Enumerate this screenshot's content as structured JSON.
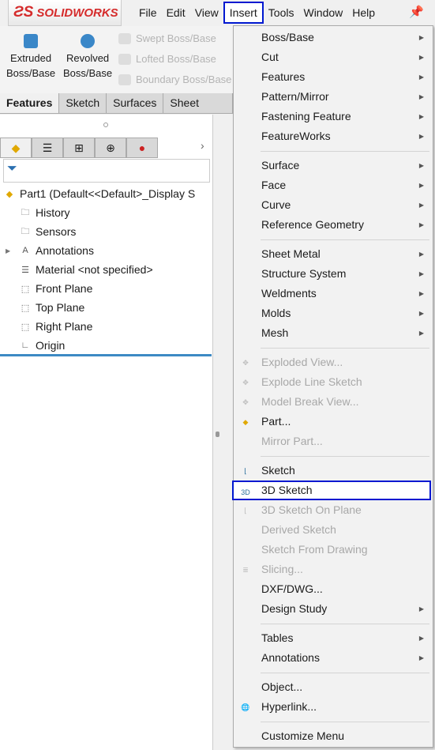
{
  "app": {
    "brand": "SOLIDWORKS"
  },
  "menubar": [
    "File",
    "Edit",
    "View",
    "Insert",
    "Tools",
    "Window",
    "Help"
  ],
  "ribbon": {
    "big": [
      {
        "label1": "Extruded",
        "label2": "Boss/Base",
        "icon": "extrude-icon"
      },
      {
        "label1": "Revolved",
        "label2": "Boss/Base",
        "icon": "revolve-icon"
      }
    ],
    "small": [
      {
        "label": "Swept Boss/Base",
        "icon": "swept-icon"
      },
      {
        "label": "Lofted Boss/Base",
        "icon": "lofted-icon"
      },
      {
        "label": "Boundary Boss/Base",
        "icon": "boundary-icon"
      }
    ]
  },
  "tabs": [
    "Features",
    "Sketch",
    "Surfaces",
    "Sheet Metal"
  ],
  "tree": {
    "root": "Part1  (Default<<Default>_Display S",
    "items": [
      {
        "label": "History",
        "icon": "history-folder-icon"
      },
      {
        "label": "Sensors",
        "icon": "sensors-folder-icon"
      },
      {
        "label": "Annotations",
        "icon": "annotations-folder-icon",
        "expandable": true
      },
      {
        "label": "Material <not specified>",
        "icon": "material-icon"
      },
      {
        "label": "Front Plane",
        "icon": "plane-icon"
      },
      {
        "label": "Top Plane",
        "icon": "plane-icon"
      },
      {
        "label": "Right Plane",
        "icon": "plane-icon"
      },
      {
        "label": "Origin",
        "icon": "origin-icon"
      }
    ]
  },
  "menu": [
    {
      "label": "Boss/Base",
      "sub": true
    },
    {
      "label": "Cut",
      "sub": true
    },
    {
      "label": "Features",
      "sub": true
    },
    {
      "label": "Pattern/Mirror",
      "sub": true
    },
    {
      "label": "Fastening Feature",
      "sub": true
    },
    {
      "label": "FeatureWorks",
      "sub": true
    },
    {
      "sep": true
    },
    {
      "label": "Surface",
      "sub": true
    },
    {
      "label": "Face",
      "sub": true
    },
    {
      "label": "Curve",
      "sub": true
    },
    {
      "label": "Reference Geometry",
      "sub": true
    },
    {
      "sep": true
    },
    {
      "label": "Sheet Metal",
      "sub": true
    },
    {
      "label": "Structure System",
      "sub": true
    },
    {
      "label": "Weldments",
      "sub": true
    },
    {
      "label": "Molds",
      "sub": true
    },
    {
      "label": "Mesh",
      "sub": true
    },
    {
      "sep": true
    },
    {
      "label": "Exploded View...",
      "disabled": true,
      "icon": "exploded-view-icon"
    },
    {
      "label": "Explode Line Sketch",
      "disabled": true,
      "icon": "explode-line-icon"
    },
    {
      "label": "Model Break View...",
      "disabled": true,
      "icon": "model-break-icon"
    },
    {
      "label": "Part...",
      "icon": "part-icon"
    },
    {
      "label": "Mirror Part...",
      "disabled": true
    },
    {
      "sep": true
    },
    {
      "label": "Sketch",
      "icon": "sketch-icon"
    },
    {
      "label": "3D Sketch",
      "icon": "3d-sketch-icon",
      "highlighted": true
    },
    {
      "label": "3D Sketch On Plane",
      "disabled": true,
      "icon": "3d-sketch-plane-icon"
    },
    {
      "label": "Derived Sketch",
      "disabled": true
    },
    {
      "label": "Sketch From Drawing",
      "disabled": true
    },
    {
      "label": "Slicing...",
      "disabled": true,
      "icon": "slicing-icon"
    },
    {
      "label": "DXF/DWG..."
    },
    {
      "label": "Design Study",
      "sub": true
    },
    {
      "sep": true
    },
    {
      "label": "Tables",
      "sub": true
    },
    {
      "label": "Annotations",
      "sub": true
    },
    {
      "sep": true
    },
    {
      "label": "Object..."
    },
    {
      "label": "Hyperlink...",
      "icon": "hyperlink-icon"
    },
    {
      "sep": true
    },
    {
      "label": "Customize Menu"
    }
  ],
  "colors": {
    "highlight": "#0018d0",
    "brand": "#d52b2b"
  }
}
